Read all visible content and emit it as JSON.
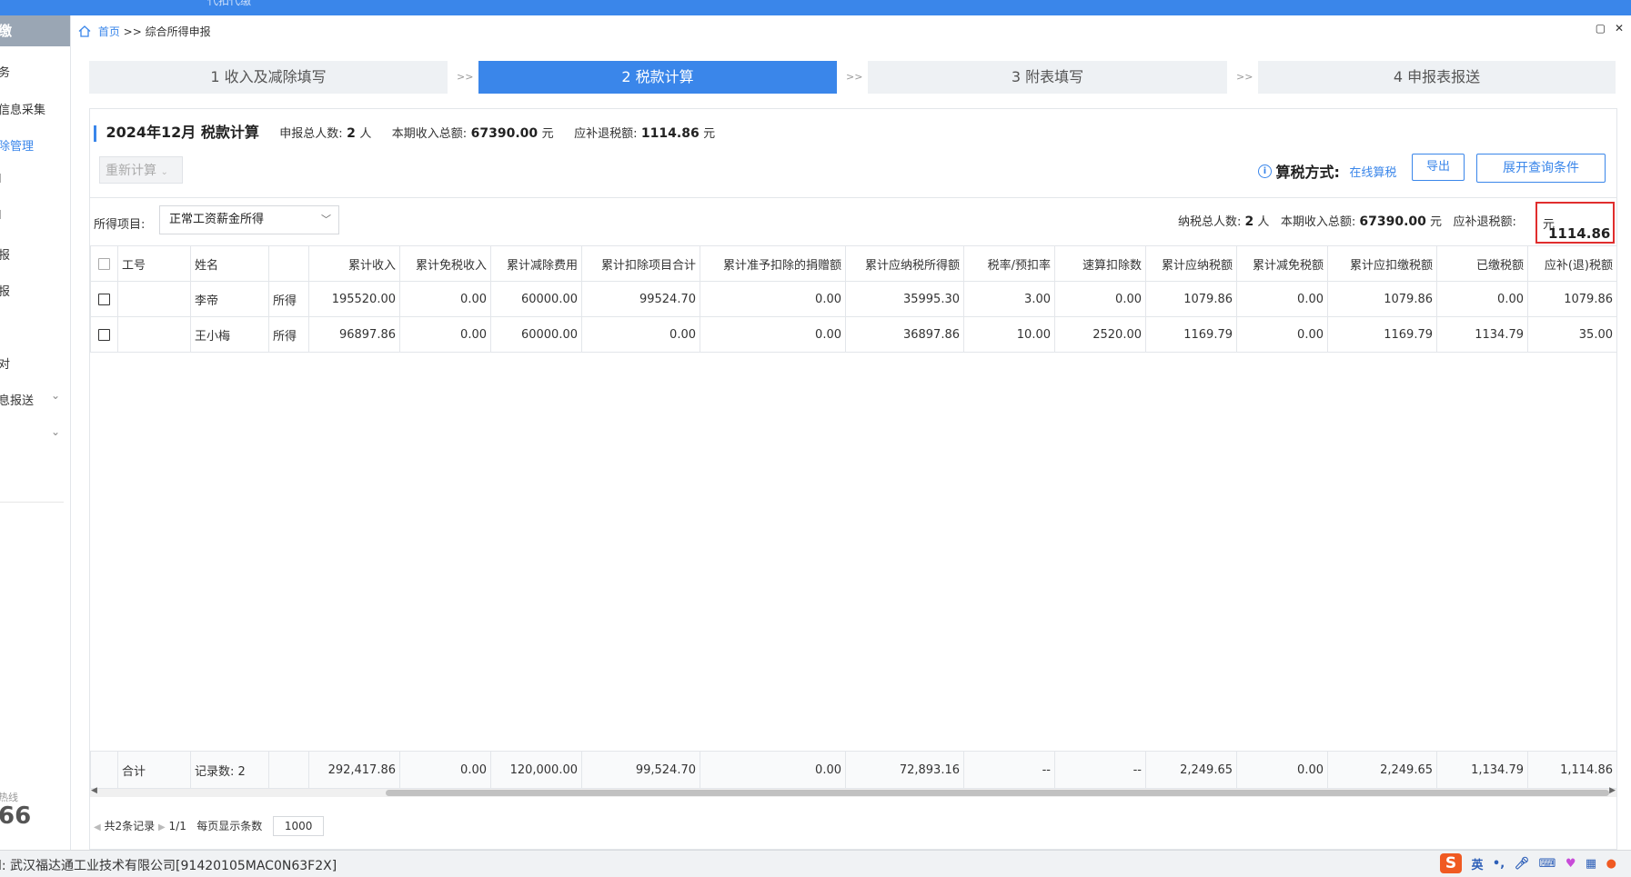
{
  "topbar": {
    "text": "代扣代缴"
  },
  "sidebar": {
    "header": "缴",
    "items": [
      {
        "label": "务",
        "active": false
      },
      {
        "label": "信息采集",
        "active": false
      },
      {
        "label": "除管理",
        "active": true
      },
      {
        "label": "l",
        "active": false
      },
      {
        "label": "l",
        "active": false
      },
      {
        "label": "报",
        "active": false
      },
      {
        "label": "报",
        "active": false
      },
      {
        "label": "对",
        "active": false
      },
      {
        "label": "息报送",
        "active": false
      }
    ],
    "chevron": "⌄",
    "hotline_label": "热线",
    "hotline_number": "66"
  },
  "breadcrumb": {
    "home": "首页",
    "separator": ">>",
    "current": "综合所得申报"
  },
  "window_controls": {
    "restore": "▢",
    "close": "✕"
  },
  "steps": [
    {
      "label": "1 收入及减除填写",
      "active": false
    },
    {
      "label": "2 税款计算",
      "active": true
    },
    {
      "label": "3 附表填写",
      "active": false
    },
    {
      "label": "4 申报表报送",
      "active": false
    }
  ],
  "step_separator": ">>",
  "header": {
    "title": "2024年12月 税款计算",
    "total_people_label": "申报总人数:",
    "total_people_value": "2",
    "total_people_unit": "人",
    "income_label": "本期收入总额:",
    "income_value": "67390.00",
    "income_unit": "元",
    "refund_label": "应补退税额:",
    "refund_value": "1114.86",
    "refund_unit": "元"
  },
  "toolbar": {
    "recalc_label": "重新计算",
    "info_icon": "i",
    "method_label": "算税方式:",
    "method_value": "在线算税",
    "export_label": "导出",
    "expand_label": "展开查询条件"
  },
  "filter": {
    "label": "所得项目:",
    "selected": "正常工资薪金所得"
  },
  "summary": {
    "people_label": "纳税总人数:",
    "people_value": "2",
    "people_unit": "人",
    "income_label": "本期收入总额:",
    "income_value": "67390.00",
    "income_unit": "元",
    "refund_label": "应补退税额:",
    "refund_value": "1114.86",
    "refund_unit": "元"
  },
  "table": {
    "columns": [
      "工号",
      "姓名",
      "",
      "累计收入",
      "累计免税收入",
      "累计减除费用",
      "累计扣除项目合计",
      "累计准予扣除的捐赠额",
      "累计应纳税所得额",
      "税率/预扣率",
      "速算扣除数",
      "累计应纳税额",
      "累计减免税额",
      "累计应扣缴税额",
      "已缴税额",
      "应补(退)税额"
    ],
    "rows": [
      [
        "",
        "李帝",
        "所得",
        "195520.00",
        "0.00",
        "60000.00",
        "99524.70",
        "0.00",
        "35995.30",
        "3.00",
        "0.00",
        "1079.86",
        "0.00",
        "1079.86",
        "0.00",
        "1079.86"
      ],
      [
        "",
        "王小梅",
        "所得",
        "96897.86",
        "0.00",
        "60000.00",
        "0.00",
        "0.00",
        "36897.86",
        "10.00",
        "2520.00",
        "1169.79",
        "0.00",
        "1169.79",
        "1134.79",
        "35.00"
      ]
    ],
    "footer": [
      "合计",
      "记录数: 2",
      "",
      "292,417.86",
      "0.00",
      "120,000.00",
      "99,524.70",
      "0.00",
      "72,893.16",
      "--",
      "--",
      "2,249.65",
      "0.00",
      "2,249.65",
      "1,134.79",
      "1,114.86"
    ]
  },
  "pager": {
    "records": "共2条记录",
    "page": "1/1",
    "page_size_label": "每页显示条数",
    "page_size": "1000"
  },
  "statusbar": {
    "text": "l: 武汉福达通工业技术有限公司[91420105MAC0N63F2X]",
    "ime_logo": "S",
    "ime_mode": "英"
  }
}
